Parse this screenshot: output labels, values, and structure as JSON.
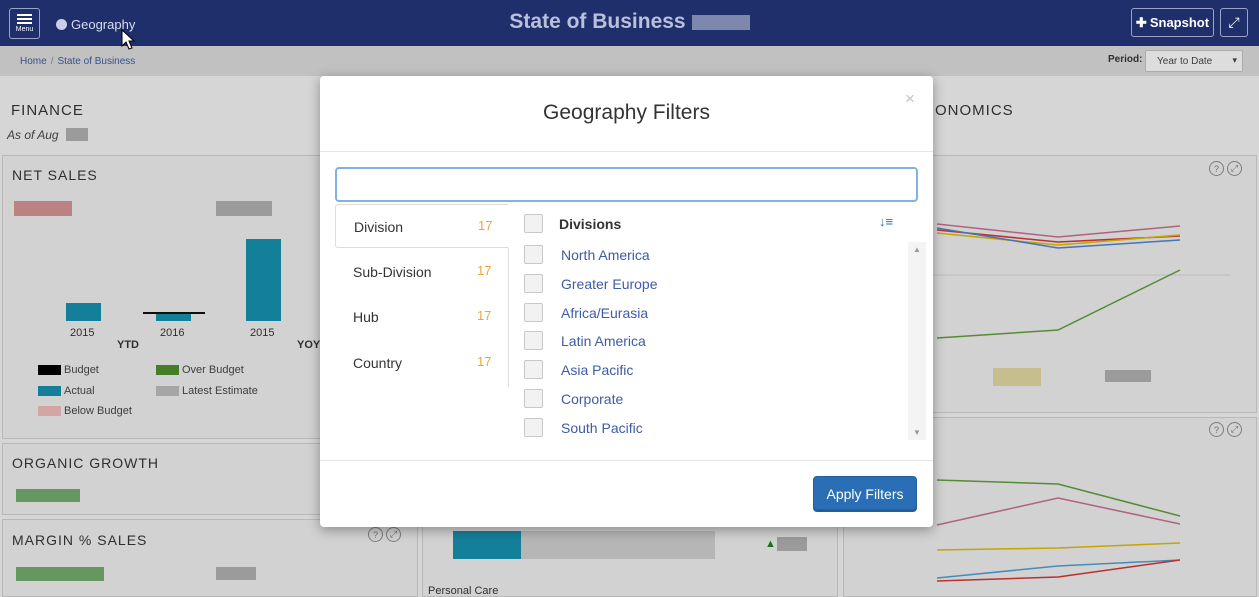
{
  "topbar": {
    "menu_label": "Menu",
    "geography_link": "Geography",
    "title": "State of Business",
    "snapshot_label": "Snapshot"
  },
  "breadcrumb": {
    "home": "Home",
    "current": "State of Business"
  },
  "period": {
    "label": "Period:",
    "selected": "Year to Date"
  },
  "dashboard": {
    "finance_heading": "FINANCE",
    "finance_asof": "As of Aug",
    "economics_heading": "ONOMICS",
    "net_sales_heading": "NET SALES",
    "x_labels": [
      "2015",
      "2016",
      "2015"
    ],
    "ytd_label": "YTD",
    "yoy_label": "YOY",
    "legend": [
      {
        "label": "Budget",
        "color": "#000000"
      },
      {
        "label": "Over Budget",
        "color": "#4a8a2c"
      },
      {
        "label": "Actual",
        "color": "#168aa6"
      },
      {
        "label": "Latest Estimate",
        "color": "#b5b5b5"
      },
      {
        "label": "Below Budget",
        "color": "#e6b3b3"
      }
    ],
    "organic_growth_heading": "ORGANIC GROWTH",
    "margin_heading": "MARGIN % SALES",
    "personal_care_label": "Personal Care"
  },
  "modal": {
    "title": "Geography Filters",
    "close": "×",
    "search_value": "",
    "tabs": [
      {
        "label": "Division",
        "count": "17",
        "active": true
      },
      {
        "label": "Sub-Division",
        "count": "17",
        "active": false
      },
      {
        "label": "Hub",
        "count": "17",
        "active": false
      },
      {
        "label": "Country",
        "count": "17",
        "active": false
      }
    ],
    "list_header": "Divisions",
    "items": [
      "North America",
      "Greater Europe",
      "Africa/Eurasia",
      "Latin America",
      "Asia Pacific",
      "Corporate",
      "South Pacific"
    ],
    "apply_label": "Apply Filters"
  }
}
